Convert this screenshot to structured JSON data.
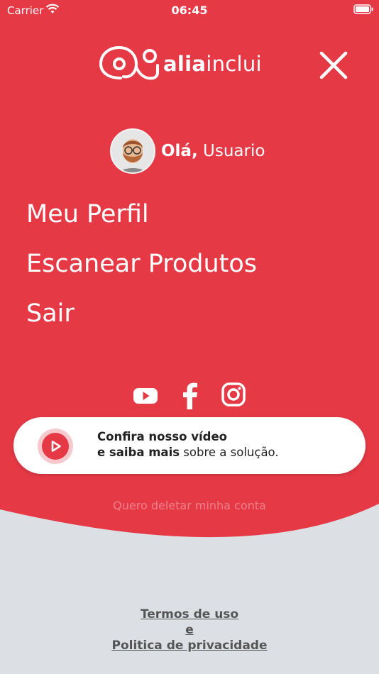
{
  "status_bar": {
    "carrier": "Carrier",
    "time": "06:45"
  },
  "brand": {
    "name_bold": "alia",
    "name_rest": "inclui"
  },
  "colors": {
    "primary": "#e63946",
    "background": "#dcdfe3",
    "text_light": "#ffffff"
  },
  "greeting": {
    "hello": "Olá,",
    "user": "Usuario"
  },
  "menu": {
    "items": [
      {
        "label": "Meu Perfil"
      },
      {
        "label": "Escanear Produtos"
      },
      {
        "label": "Sair"
      }
    ]
  },
  "social": {
    "icons": [
      "youtube-icon",
      "facebook-icon",
      "instagram-icon"
    ]
  },
  "video_card": {
    "line1_bold": "Confira nosso vídeo",
    "line2_bold": "e saiba mais",
    "line2_rest": "sobre a solução."
  },
  "delete_account": "Quero deletar minha conta",
  "footer": {
    "terms": "Termos de uso",
    "and": "e",
    "privacy": "Politica de privacidade"
  }
}
